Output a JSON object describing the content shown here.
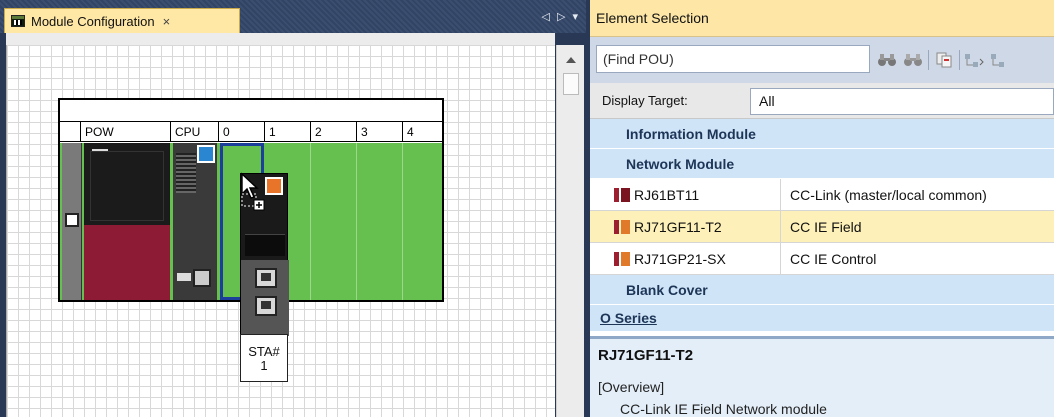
{
  "module_config": {
    "tab_title": "Module Configuration",
    "tab_close": "×",
    "tab_nav_left": "◁",
    "tab_nav_right": "▷",
    "tab_nav_menu": "▾",
    "slots": [
      "POW",
      "CPU",
      "0",
      "1",
      "2",
      "3",
      "4"
    ],
    "sta_label": "STA#\n1"
  },
  "element_selection": {
    "title": "Element Selection",
    "search_placeholder": "(Find POU)",
    "display_target_label": "Display Target:",
    "display_target_value": "All",
    "categories": [
      {
        "label": "Information Module"
      },
      {
        "label": "Network Module"
      }
    ],
    "items": [
      {
        "name": "RJ61BT11",
        "desc": "CC-Link (master/local common)",
        "selected": false
      },
      {
        "name": "RJ71GF11-T2",
        "desc": "CC IE Field",
        "selected": true
      },
      {
        "name": "RJ71GP21-SX",
        "desc": "CC IE Control",
        "selected": false
      }
    ],
    "blank_cover": "Blank Cover",
    "series_label": "O Series",
    "detail": {
      "title": "RJ71GF11-T2",
      "overview_label": "[Overview]",
      "description": "CC-Link IE Field Network module"
    }
  },
  "colors": {
    "tab_active": "#ffe8a6",
    "base_green": "#66c050",
    "category_blue": "#cfe4f6",
    "selected_row": "#fdf0b8"
  },
  "icons": {
    "tab_icon": "module-config-icon",
    "toolbar": [
      "binoculars-icon",
      "binoculars-next-icon",
      "copy-icon",
      "expand-icon",
      "collapse-icon"
    ]
  }
}
